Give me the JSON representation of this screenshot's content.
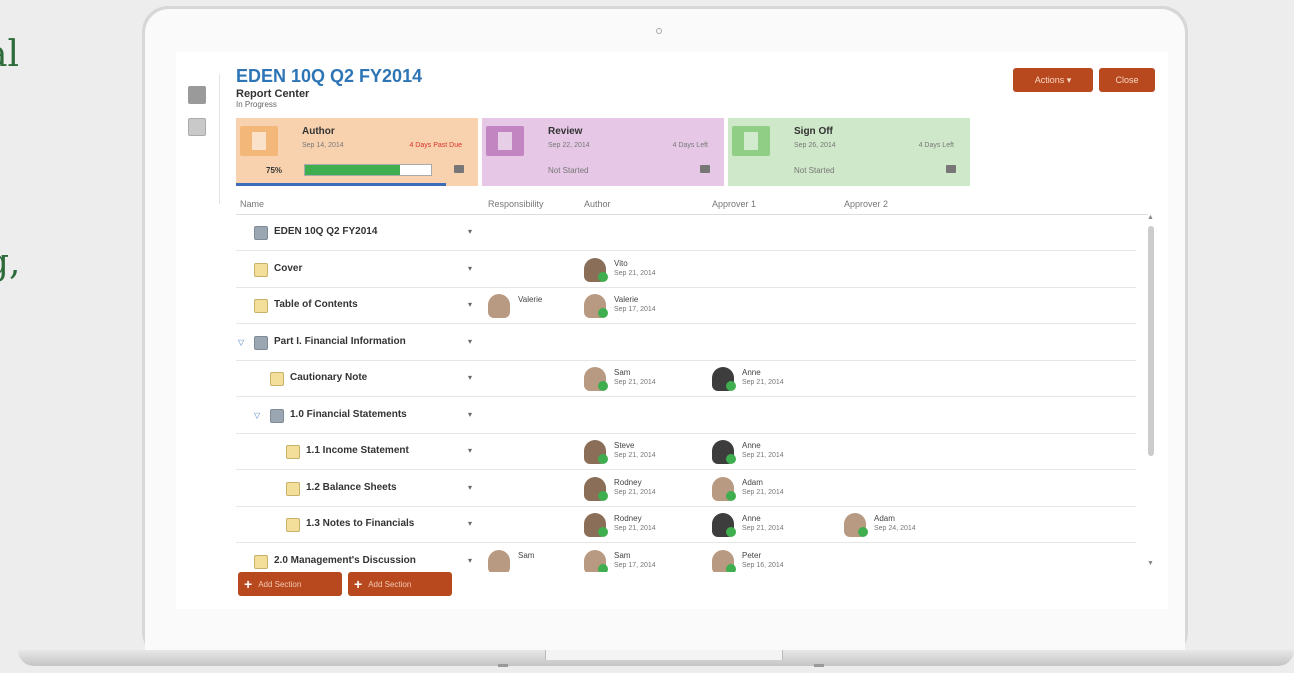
{
  "background_text": [
    "al",
    "g,"
  ],
  "report": {
    "title": "EDEN 10Q Q2 FY2014",
    "subtitle": "Report Center",
    "status": "In Progress"
  },
  "header_buttons": {
    "actions": "Actions ▾",
    "close": "Close"
  },
  "stages": [
    {
      "name": "Author",
      "date": "Sep 14, 2014",
      "days": "4 Days Past Due",
      "progress_label": "75%",
      "progress": 0.75,
      "color": "#f8d2ae",
      "box_color": "#f3b77a",
      "days_color": "#d9342b"
    },
    {
      "name": "Review",
      "date": "Sep 22, 2014",
      "days": "4 Days Left",
      "state": "Not Started",
      "color": "#e6c8e6",
      "box_color": "#c285c2",
      "days_color": "#777777"
    },
    {
      "name": "Sign Off",
      "date": "Sep 26, 2014",
      "days": "4 Days Left",
      "state": "Not Started",
      "color": "#cfe8c9",
      "box_color": "#8fce84",
      "days_color": "#777777"
    }
  ],
  "columns": [
    "Name",
    "Responsibility",
    "Author",
    "Approver 1",
    "Approver 2"
  ],
  "rows": [
    {
      "name": "EDEN 10Q Q2 FY2014",
      "icon": "grid",
      "indent": 0,
      "caret": ""
    },
    {
      "name": "Cover",
      "icon": "doc",
      "indent": 0,
      "caret": "",
      "author": {
        "name": "Vito",
        "date": "Sep 21, 2014"
      }
    },
    {
      "name": "Table of Contents",
      "icon": "doc",
      "indent": 0,
      "caret": "",
      "resp": {
        "name": "Valerie"
      },
      "author": {
        "name": "Valerie",
        "date": "Sep 17, 2014"
      }
    },
    {
      "name": "Part I. Financial Information",
      "icon": "grid",
      "indent": 0,
      "caret": "▽"
    },
    {
      "name": "Cautionary Note",
      "icon": "doc",
      "indent": 1,
      "caret": "",
      "author": {
        "name": "Sam",
        "date": "Sep 21, 2014"
      },
      "approver1": {
        "name": "Anne",
        "date": "Sep 21, 2014"
      }
    },
    {
      "name": "1.0 Financial Statements",
      "icon": "grid",
      "indent": 1,
      "caret": "▽"
    },
    {
      "name": "1.1 Income Statement",
      "icon": "doc",
      "indent": 2,
      "caret": "",
      "author": {
        "name": "Steve",
        "date": "Sep 21, 2014"
      },
      "approver1": {
        "name": "Anne",
        "date": "Sep 21, 2014"
      }
    },
    {
      "name": "1.2 Balance Sheets",
      "icon": "doc",
      "indent": 2,
      "caret": "",
      "author": {
        "name": "Rodney",
        "date": "Sep 21, 2014"
      },
      "approver1": {
        "name": "Adam",
        "date": "Sep 21, 2014"
      }
    },
    {
      "name": "1.3 Notes to Financials",
      "icon": "doc",
      "indent": 2,
      "caret": "",
      "author": {
        "name": "Rodney",
        "date": "Sep 21, 2014"
      },
      "approver1": {
        "name": "Anne",
        "date": "Sep 21, 2014"
      },
      "approver2": {
        "name": "Adam",
        "date": "Sep 24, 2014"
      }
    },
    {
      "name": "2.0 Management's Discussion",
      "icon": "doc",
      "indent": 0,
      "caret": "",
      "resp": {
        "name": "Sam"
      },
      "author": {
        "name": "Sam",
        "date": "Sep 17, 2014"
      },
      "approver1": {
        "name": "Peter",
        "date": "Sep 16, 2014"
      }
    }
  ],
  "footer_buttons": [
    "Add Section",
    "Add Section"
  ]
}
